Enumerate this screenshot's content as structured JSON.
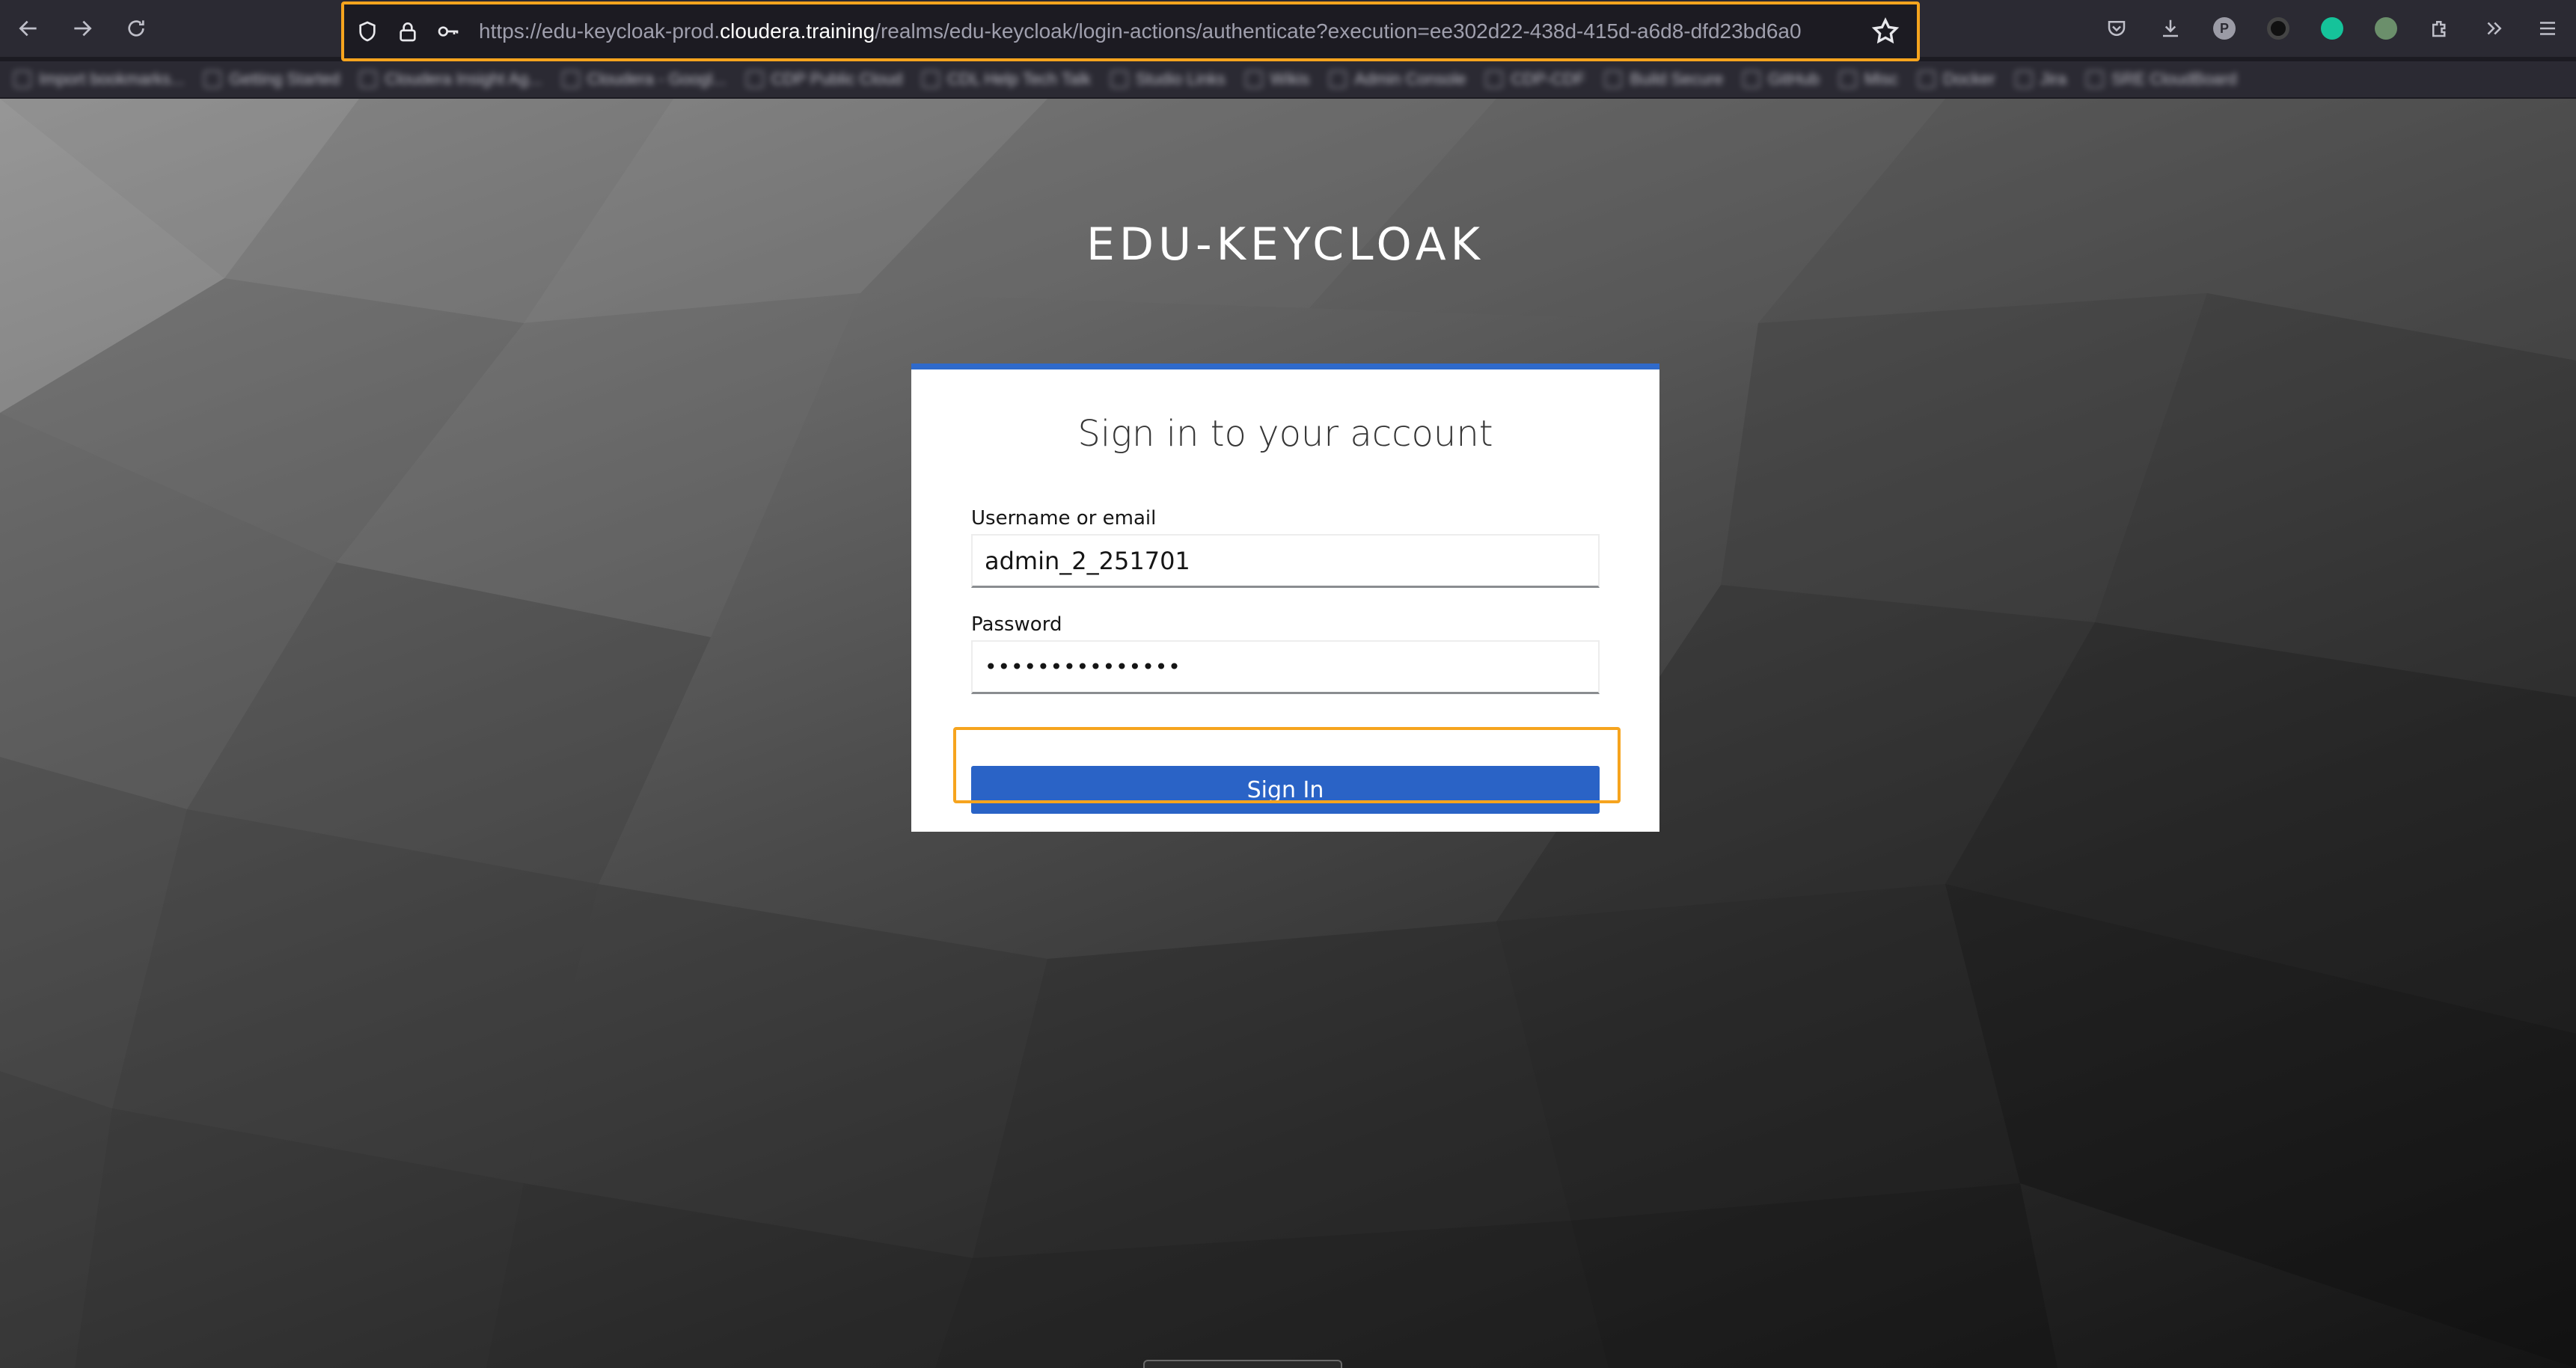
{
  "browser": {
    "url_prefix": "https://edu-keycloak-prod.",
    "url_host": "cloudera.training",
    "url_suffix": "/realms/edu-keycloak/login-actions/authenticate?execution=ee302d22-438d-415d-a6d8-dfd23bd6a0",
    "bookmarks": [
      "Import bookmarks...",
      "Getting Started",
      "Cloudera Insight Ag...",
      "Cloudera - Googl...",
      "CDP Public Cloud",
      "CDL Help Tech Talk",
      "Studio Links",
      "Wikis",
      "Admin Console",
      "CDP-CDF",
      "Build Secure",
      "GitHub",
      "Misc",
      "Docker",
      "Jira",
      "SRE CloudBoard"
    ]
  },
  "login": {
    "realm_title": "EDU-KEYCLOAK",
    "heading": "Sign in to your account",
    "username_label": "Username or email",
    "username_value": "admin_2_251701",
    "password_label": "Password",
    "password_value": "•••••••••••••••",
    "submit_label": "Sign In"
  },
  "colors": {
    "highlight": "#f6a41e",
    "button": "#2a63c6",
    "card_accent": "#2f6acb"
  }
}
